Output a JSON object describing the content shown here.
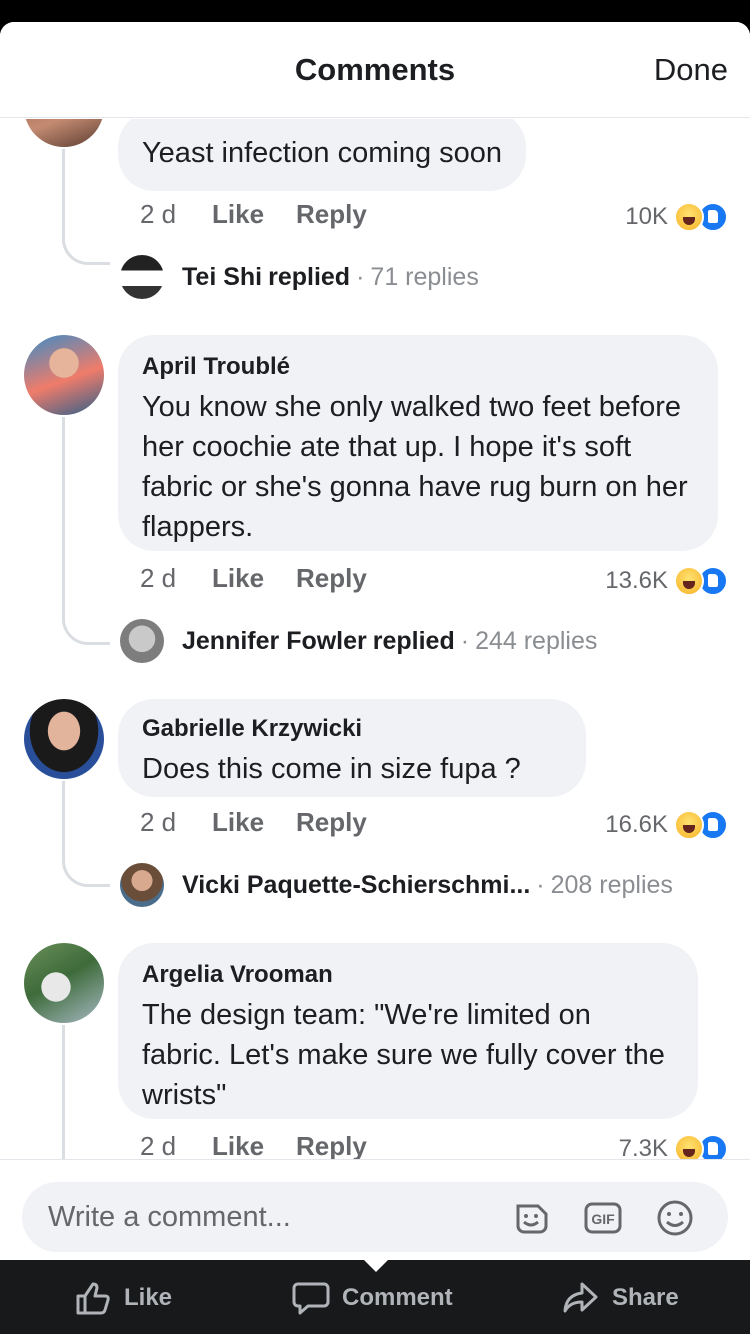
{
  "header": {
    "title": "Comments",
    "done_label": "Done"
  },
  "comments": [
    {
      "author": "",
      "text": "Yeast infection coming soon",
      "time": "2 d",
      "like_label": "Like",
      "reply_label": "Reply",
      "reaction_count": "10K",
      "replied_by": "Tei Shi",
      "replied_verb": "replied",
      "replies_count": "71 replies"
    },
    {
      "author": "April Troublé",
      "text": "You know she only walked two feet before her coochie ate that up.  I hope it's soft fabric or she's gonna have rug burn on her flappers.",
      "time": "2 d",
      "like_label": "Like",
      "reply_label": "Reply",
      "reaction_count": "13.6K",
      "replied_by": "Jennifer Fowler",
      "replied_verb": "replied",
      "replies_count": "244 replies"
    },
    {
      "author": "Gabrielle Krzywicki",
      "text": "Does this come in size fupa ?",
      "time": "2 d",
      "like_label": "Like",
      "reply_label": "Reply",
      "reaction_count": "16.6K",
      "replied_by": "Vicki Paquette-Schierschmi...",
      "replied_verb": "",
      "replies_count": "208 replies"
    },
    {
      "author": "Argelia Vrooman",
      "text": "The design team: \"We're limited on fabric. Let's make sure we fully cover the wrists\"",
      "time": "2 d",
      "like_label": "Like",
      "reply_label": "Reply",
      "reaction_count": "7.3K"
    }
  ],
  "composer": {
    "placeholder": "Write a comment..."
  },
  "bottom_bar": {
    "like": "Like",
    "comment": "Comment",
    "share": "Share"
  },
  "colors": {
    "bubble": "#f0f2f5",
    "secondary_text": "#65676b",
    "brand_blue": "#1877f2",
    "haha_yellow": "#f7b125"
  },
  "icons": [
    "sticker-icon",
    "gif-icon",
    "emoji-icon",
    "thumbs-up-icon",
    "comment-icon",
    "share-icon",
    "haha-reaction-icon",
    "like-reaction-icon"
  ]
}
